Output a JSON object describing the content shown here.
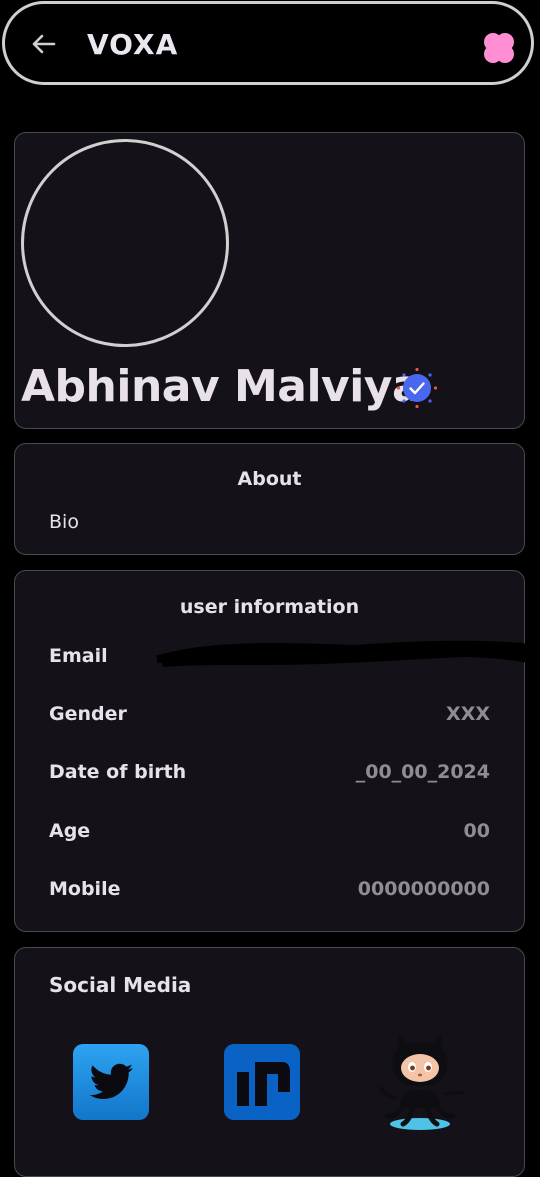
{
  "app": {
    "title": "VOXA"
  },
  "icons": {
    "back": "arrow-back-icon",
    "menu": "flower-menu-icon",
    "verified": "verified-badge-icon",
    "twitter": "twitter-icon",
    "nostr": "n-logo-icon",
    "github": "github-octocat-icon"
  },
  "profile": {
    "name": "Abhinav Malviya"
  },
  "about": {
    "heading": "About",
    "bio": "Bio"
  },
  "user_info": {
    "heading": "user information",
    "rows": [
      {
        "label": "Email",
        "value": ""
      },
      {
        "label": "Gender",
        "value": "XXX"
      },
      {
        "label": "Date of birth",
        "value": "_00_00_2024"
      },
      {
        "label": "Age",
        "value": "00"
      },
      {
        "label": "Mobile",
        "value": "0000000000"
      }
    ]
  },
  "social": {
    "heading": "Social Media"
  },
  "colors": {
    "background": "#000000",
    "card": "#141218",
    "accent_pink": "#ff8fd2",
    "verified_blue": "#4a67f0",
    "twitter_blue": "#1d8fe0",
    "nostr_blue": "#0a63c4"
  }
}
